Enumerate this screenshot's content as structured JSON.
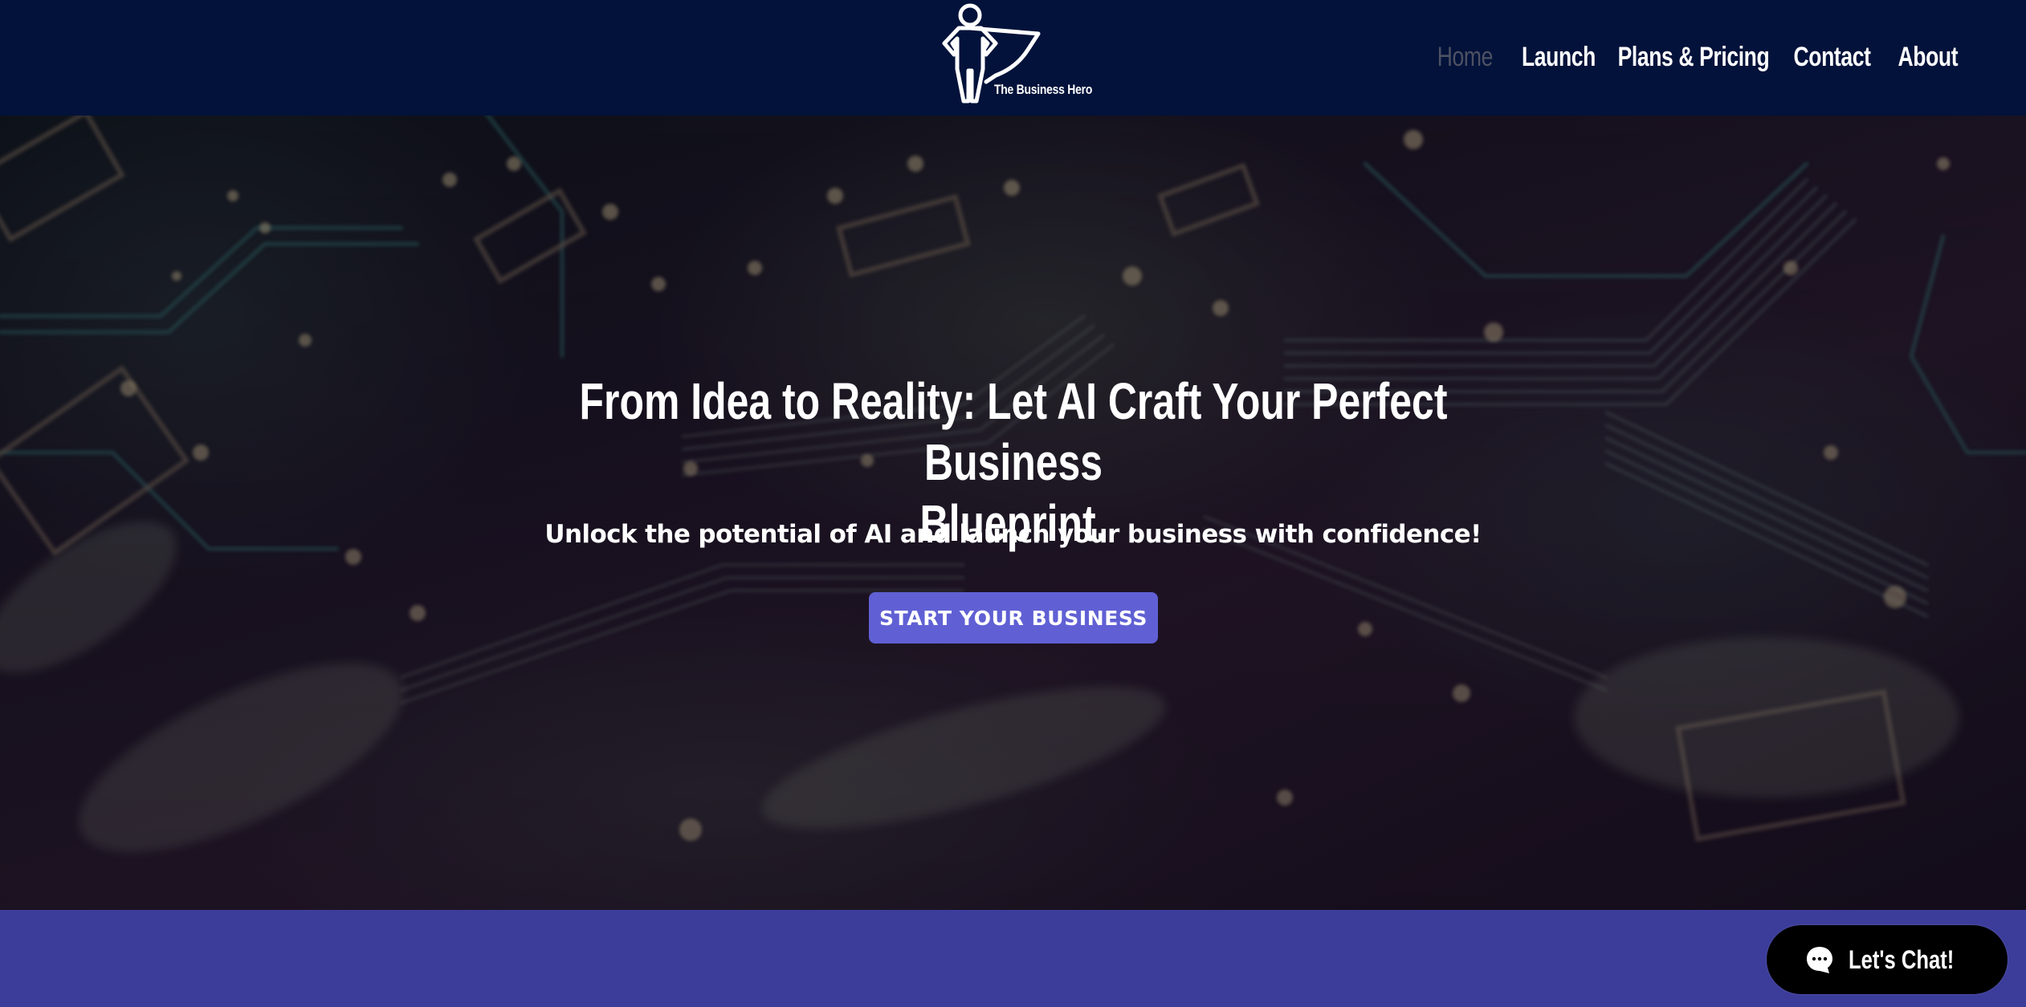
{
  "site": {
    "brand_name": "The Business Hero"
  },
  "nav": {
    "items": [
      {
        "label": "Home",
        "active": true
      },
      {
        "label": "Launch",
        "active": false
      },
      {
        "label": "Plans & Pricing",
        "active": false
      },
      {
        "label": "Contact",
        "active": false
      },
      {
        "label": "About",
        "active": false
      }
    ]
  },
  "hero": {
    "title_line1": "From Idea to Reality: Let AI Craft Your Perfect Business",
    "title_line2": "Blueprint.",
    "subtitle": "Unlock the potential of AI and launch your business with confidence!",
    "cta_label": "START YOUR BUSINESS",
    "background_image": "circuit-board-photo"
  },
  "chat": {
    "label": "Let's Chat!",
    "icon": "chat-bubble-icon"
  },
  "colors": {
    "header_bg": "#02123a",
    "nav_active": "#4d5163",
    "nav_text": "#ffffff",
    "cta_bg": "#6060d4",
    "band_bg": "#3c3d9b",
    "chat_bg": "#000000"
  }
}
